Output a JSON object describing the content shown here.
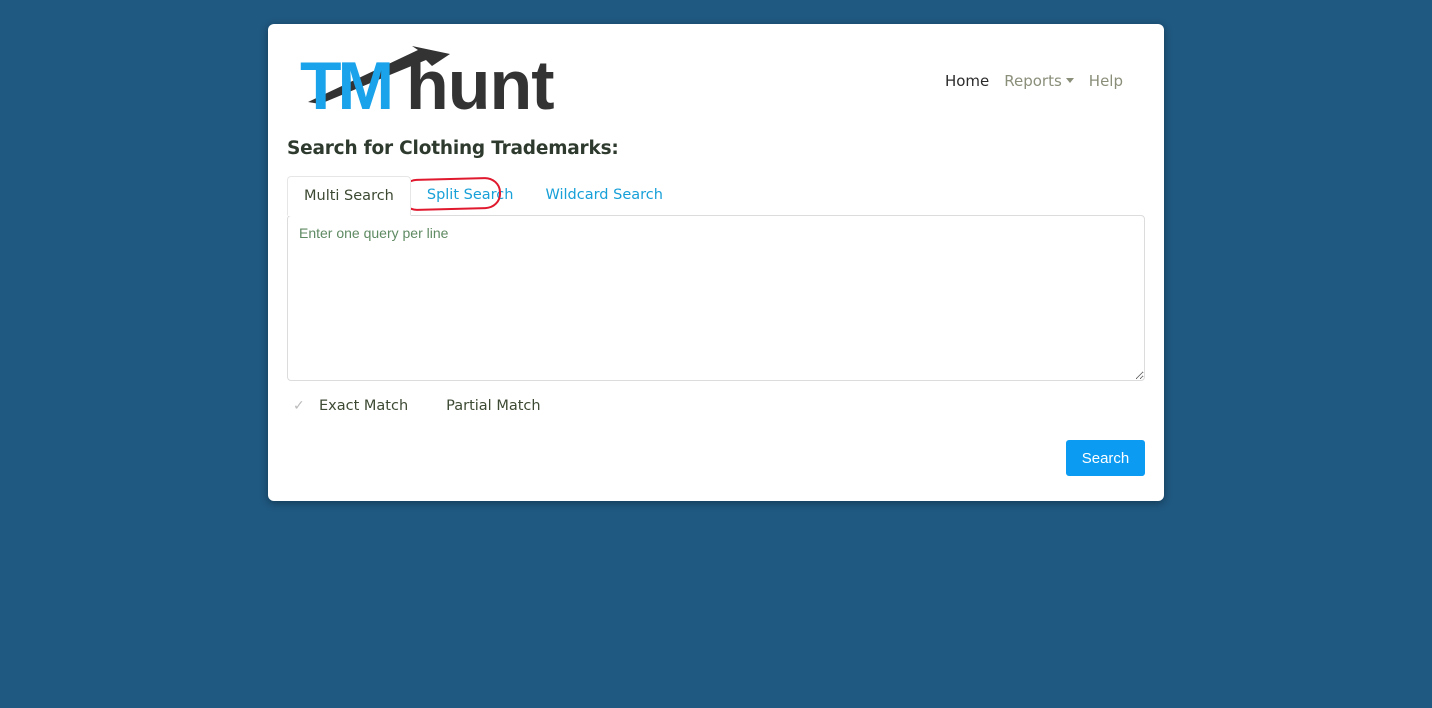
{
  "logo": {
    "text_tm": "TM",
    "text_hunt": "hunt",
    "colors": {
      "tm": "#1aa3ea",
      "hunt": "#333333"
    }
  },
  "nav": {
    "items": [
      {
        "label": "Home",
        "active": true
      },
      {
        "label": "Reports",
        "dropdown": true
      },
      {
        "label": "Help"
      }
    ]
  },
  "page": {
    "title": "Search for Clothing Trademarks:"
  },
  "tabs": [
    {
      "label": "Multi Search",
      "active": true
    },
    {
      "label": "Split Search",
      "annotated": "red-circle"
    },
    {
      "label": "Wildcard Search"
    }
  ],
  "query": {
    "value": "",
    "placeholder": "Enter one query per line"
  },
  "match": {
    "exact_label": "Exact Match",
    "partial_label": "Partial Match",
    "exact_checked": true
  },
  "search_button": {
    "label": "Search"
  },
  "colors": {
    "background": "#1f5880",
    "accent": "#0b9bf2",
    "tab_link": "#18a0d8",
    "annotation": "#e0192e"
  }
}
